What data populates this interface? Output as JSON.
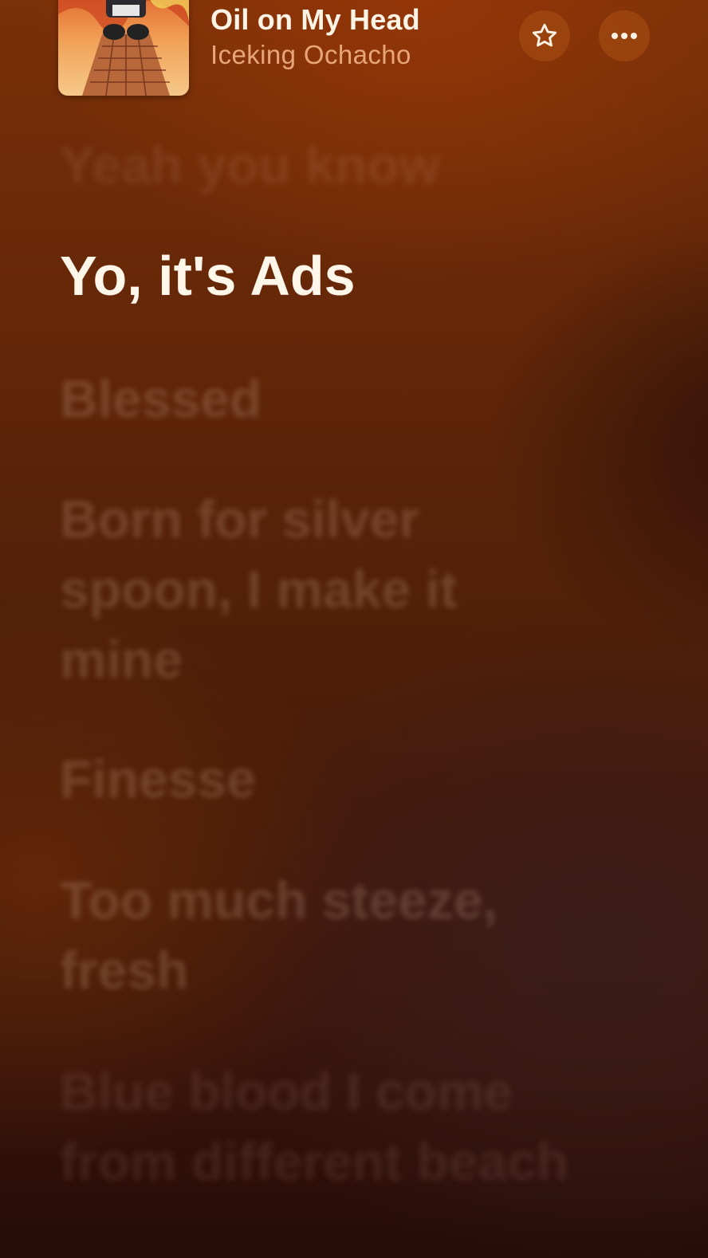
{
  "now_playing": {
    "title": "Oil on My Head",
    "artist": "Iceking Ochacho",
    "artwork_icon": "album-artwork"
  },
  "controls": {
    "favorite_icon": "star-icon",
    "more_icon": "ellipsis-icon"
  },
  "lyrics": [
    {
      "text": "Yeah you know",
      "state": "past"
    },
    {
      "text": "Yo, it's Ads",
      "state": "current"
    },
    {
      "text": "Blessed",
      "state": "upcoming"
    },
    {
      "text": "Born for silver",
      "state": "upcoming"
    },
    {
      "text": "spoon, I make it",
      "state": "upcoming"
    },
    {
      "text": "mine",
      "state": "upcoming"
    },
    {
      "text": "Finesse",
      "state": "upcoming"
    },
    {
      "text": "Too much steeze,",
      "state": "upcoming"
    },
    {
      "text": "fresh",
      "state": "upcoming"
    },
    {
      "text": "Blue blood I come",
      "state": "upcoming"
    },
    {
      "text": "from different beach",
      "state": "upcoming"
    }
  ],
  "colors": {
    "accent_title": "#fff3e6",
    "accent_artist": "#e8a57a",
    "background_top": "#7a3008",
    "background_bottom": "#260c06"
  }
}
